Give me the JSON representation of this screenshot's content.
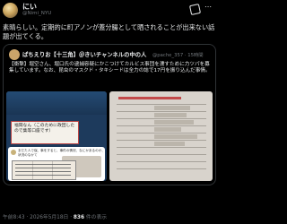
{
  "author": {
    "name": "にい",
    "handle": "@Nimi_NYU"
  },
  "tweet_text": "素晴らしい。定期的に町アノンが蓋分腸として晒されることが出来ない話題が出てくる。",
  "quote": {
    "name": "ぱちえりお【十三角】＠きいチャンネルの中の人",
    "handle": "@pache_357 · 15時間",
    "text": "【衝撃】堀空さん、堀口氏の逮捕容疑にかこつけてカルビス事団を濡すために力ツパを募集しています。なお、昆虫のマスクド・タキシードは全力の誌で17円を振り込んだ事情。"
  },
  "images": {
    "doc_text": "福岡なん（このために政団したので集等口座です）",
    "card_text": "まだた人で保、事をすると、事件の情況、なにかあるのか、状況のなかて",
    "right_labels": [
      "お名前",
      "電話番号",
      "年齢",
      "メールアドレス",
      "住所"
    ]
  },
  "meta": {
    "time": "午前8:43 · 2026年5月18日 ·",
    "views": "836",
    "views_label": "件の表示"
  }
}
